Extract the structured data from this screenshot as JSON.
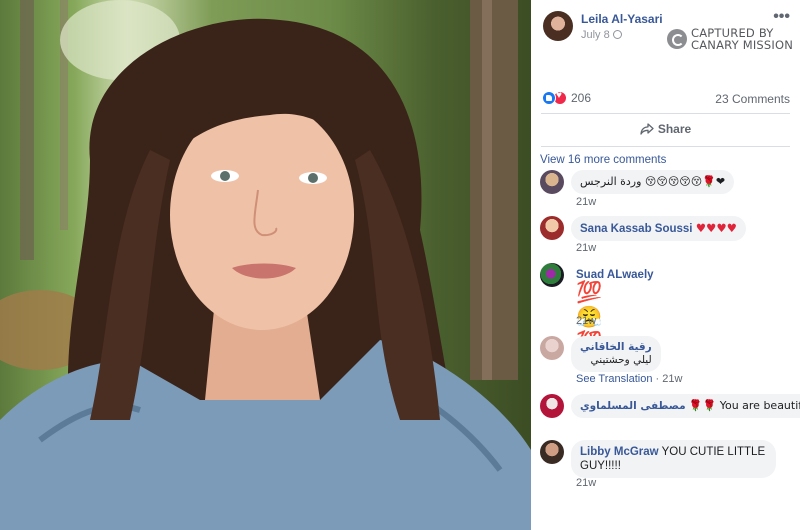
{
  "post": {
    "author": "Leila Al-Yasari",
    "date": "July 8",
    "watermark": [
      "CAPTURED BY",
      "CANARY MISSION"
    ],
    "reaction_count": "206",
    "comment_count": "23 Comments",
    "share_label": "Share",
    "view_more": "View 16 more comments"
  },
  "comments": [
    {
      "name": "",
      "text": "وردة النرجس 😚😚😚😚😚🌹❤",
      "time": "21w"
    },
    {
      "name": "Sana Kassab Soussi",
      "text": "♥♥♥♥",
      "time": "21w"
    },
    {
      "name": "Suad ALwaely",
      "text": "💯😤💯",
      "time": "21w"
    },
    {
      "name": "رقية الخاقاني",
      "text": "ليلي وحشتيني",
      "translate": "See Translation",
      "time": "21w"
    },
    {
      "name": "مصطفى المسلماوي",
      "text": "🌹🌹 You are beautiful",
      "time": ""
    },
    {
      "name": "Libby McGraw",
      "text_line1": "YOU CUTIE LITTLE",
      "text_line2": "GUY!!!!!",
      "time": "21w"
    }
  ],
  "colors": {
    "link": "#385898",
    "like": "#1877f2",
    "love": "#f0284a",
    "bubble": "#f2f3f5"
  },
  "icons": [
    "globe-icon",
    "more-icon",
    "like-icon",
    "love-icon",
    "share-icon"
  ]
}
